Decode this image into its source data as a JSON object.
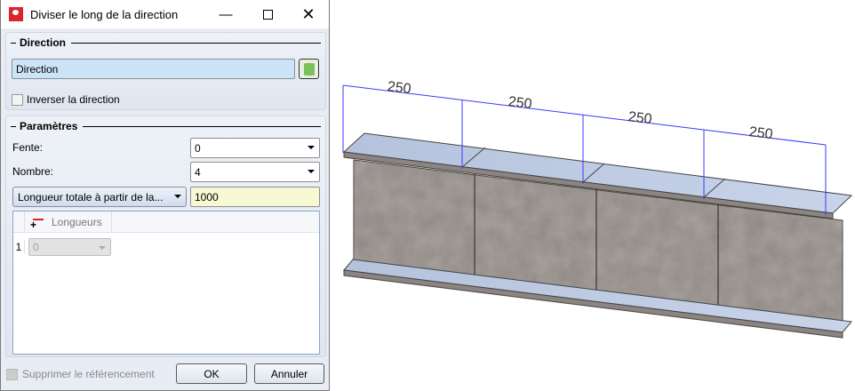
{
  "window": {
    "title": "Diviser le long de la direction",
    "minimize_icon": "minimize-icon",
    "maximize_icon": "maximize-icon",
    "close_icon": "close-icon"
  },
  "direction_group": {
    "title": "Direction",
    "field_value": "Direction",
    "pick_icon": "pick-direction-icon",
    "reverse_label": "Inverser la direction",
    "reverse_checked": false
  },
  "params_group": {
    "title": "Paramètres",
    "fente_label": "Fente:",
    "fente_value": "0",
    "nombre_label": "Nombre:",
    "nombre_value": "4",
    "mode_value": "Longueur totale à partir de la...",
    "total_value": "1000",
    "table": {
      "column_header": "Longueurs",
      "rows": [
        {
          "index": "1",
          "value": "0"
        }
      ]
    }
  },
  "footer": {
    "suppress_label": "Supprimer le référencement",
    "ok_label": "OK",
    "cancel_label": "Annuler"
  },
  "viewport": {
    "dimensions": [
      "250",
      "250",
      "250",
      "250"
    ],
    "dimension_color": "#3a3aff"
  }
}
